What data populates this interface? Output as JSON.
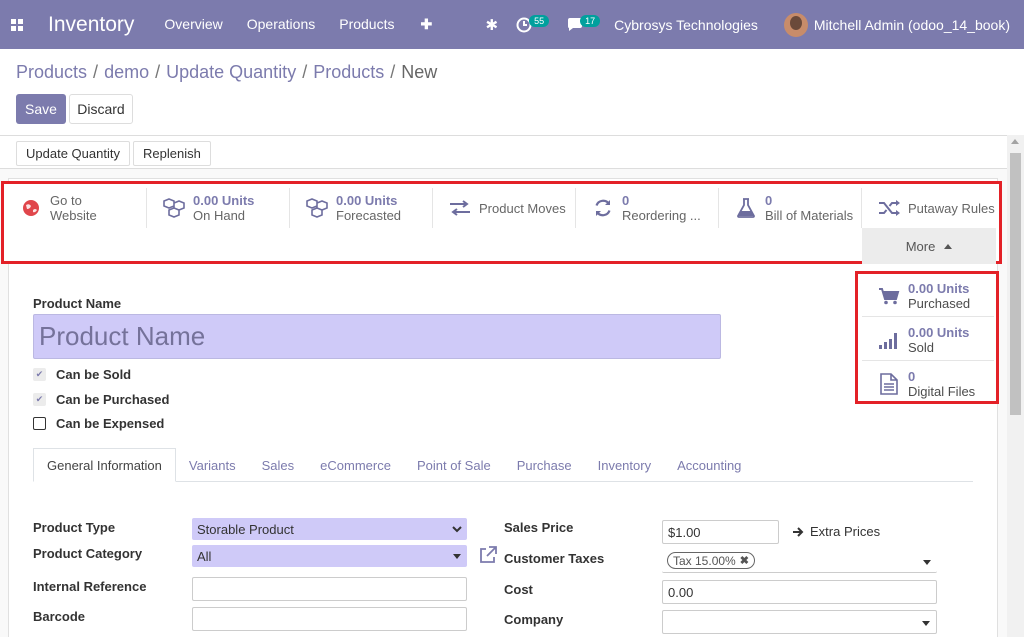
{
  "navbar": {
    "app_title": "Inventory",
    "menu": [
      "Overview",
      "Operations",
      "Products"
    ],
    "plus_label": "✚",
    "bug_label": "✱",
    "activity_count": "55",
    "messages_count": "17",
    "company": "Cybrosys Technologies",
    "user": "Mitchell Admin (odoo_14_book)"
  },
  "breadcrumb": {
    "items": [
      "Products",
      "demo",
      "Update Quantity",
      "Products"
    ],
    "current": "New",
    "separator": "/"
  },
  "actions": {
    "save": "Save",
    "discard": "Discard"
  },
  "statusbar": {
    "update_quantity": "Update Quantity",
    "replenish": "Replenish"
  },
  "smart_buttons": [
    {
      "icon": "globe-icon",
      "value": "Go to",
      "label": "Website"
    },
    {
      "icon": "cubes-icon",
      "value": "0.00 Units",
      "label": "On Hand"
    },
    {
      "icon": "cubes-icon",
      "value": "0.00 Units",
      "label": "Forecasted"
    },
    {
      "icon": "exchange-icon",
      "value": "",
      "label": "Product Moves"
    },
    {
      "icon": "refresh-icon",
      "value": "0",
      "label": "Reordering ..."
    },
    {
      "icon": "flask-icon",
      "value": "0",
      "label": "Bill of Materials"
    },
    {
      "icon": "random-icon",
      "value": "",
      "label": "Putaway Rules"
    }
  ],
  "more_label": "More",
  "more_dropdown": [
    {
      "icon": "cart-icon",
      "value": "0.00 Units",
      "label": "Purchased"
    },
    {
      "icon": "signal-icon",
      "value": "0.00 Units",
      "label": "Sold"
    },
    {
      "icon": "file-icon",
      "value": "0",
      "label": "Digital Files"
    }
  ],
  "product": {
    "name_label": "Product Name",
    "name_placeholder": "Product Name",
    "checkboxes": [
      {
        "label": "Can be Sold",
        "checked": true
      },
      {
        "label": "Can be Purchased",
        "checked": true
      },
      {
        "label": "Can be Expensed",
        "checked": false
      }
    ]
  },
  "tabs": [
    "General Information",
    "Variants",
    "Sales",
    "eCommerce",
    "Point of Sale",
    "Purchase",
    "Inventory",
    "Accounting"
  ],
  "fields": {
    "product_type_label": "Product Type",
    "product_type_value": "Storable Product",
    "product_category_label": "Product Category",
    "product_category_value": "All",
    "internal_reference_label": "Internal Reference",
    "barcode_label": "Barcode",
    "sales_price_label": "Sales Price",
    "sales_price_value": "$1.00",
    "extra_prices": "Extra Prices",
    "customer_taxes_label": "Customer Taxes",
    "customer_taxes_tag": "Tax 15.00%",
    "cost_label": "Cost",
    "cost_value": "0.00",
    "company_label": "Company"
  },
  "colors": {
    "brand": "#7c7bad",
    "highlight": "#e32127",
    "input_required": "#cfcaf8"
  }
}
